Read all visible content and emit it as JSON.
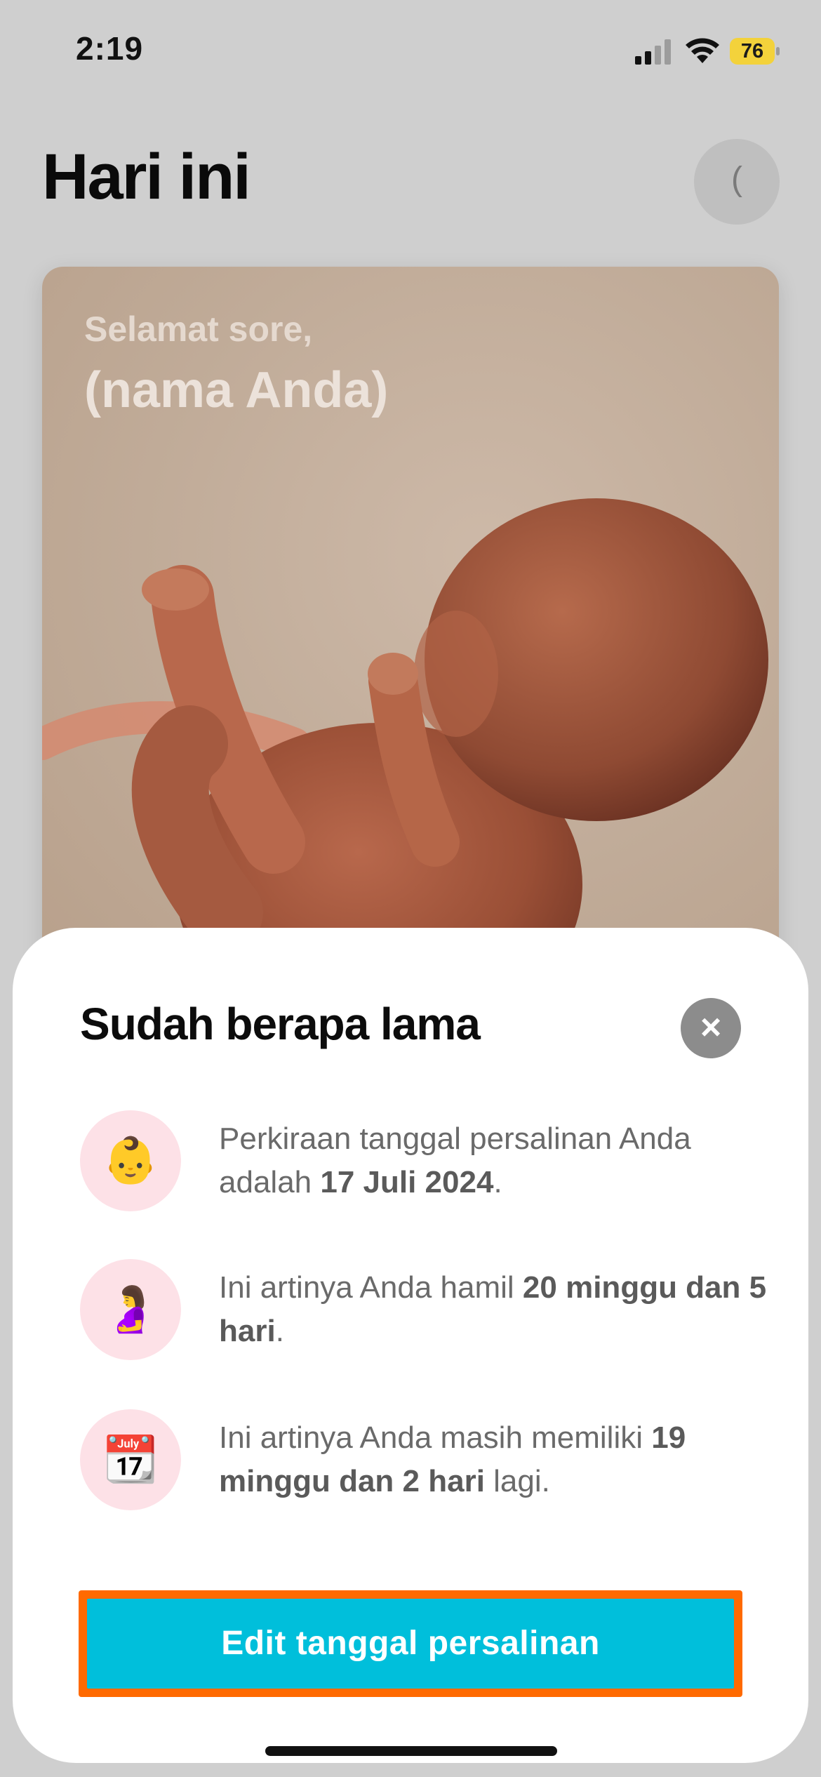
{
  "status_bar": {
    "time": "2:19",
    "battery_level": "76",
    "icons": [
      "cellular-signal-icon",
      "wifi-icon",
      "battery-icon"
    ]
  },
  "header": {
    "title": "Hari ini",
    "avatar_glyph": "("
  },
  "hero": {
    "greeting": "Selamat sore,",
    "name": "(nama Anda)"
  },
  "sheet": {
    "title": "Sudah berapa lama",
    "close_icon": "×",
    "items": [
      {
        "icon": "baby-face-icon",
        "emoji": "👶",
        "text_before": "Perkiraan tanggal persalinan Anda adalah ",
        "text_bold": "17 Juli 2024",
        "text_after": "."
      },
      {
        "icon": "pregnant-woman-icon",
        "emoji": "🤰",
        "text_before": "Ini artinya Anda hamil ",
        "text_bold": "20 minggu dan 5 hari",
        "text_after": "."
      },
      {
        "icon": "calendar-icon",
        "emoji": "📆",
        "text_before": "Ini artinya Anda masih memiliki ",
        "text_bold": "19 minggu dan 2 hari",
        "text_after": " lagi."
      }
    ],
    "edit_button_label": "Edit tanggal persalinan"
  },
  "colors": {
    "accent": "#00bfdb",
    "highlight_border": "#ff6a00",
    "icon_bg": "#fde1e7"
  }
}
